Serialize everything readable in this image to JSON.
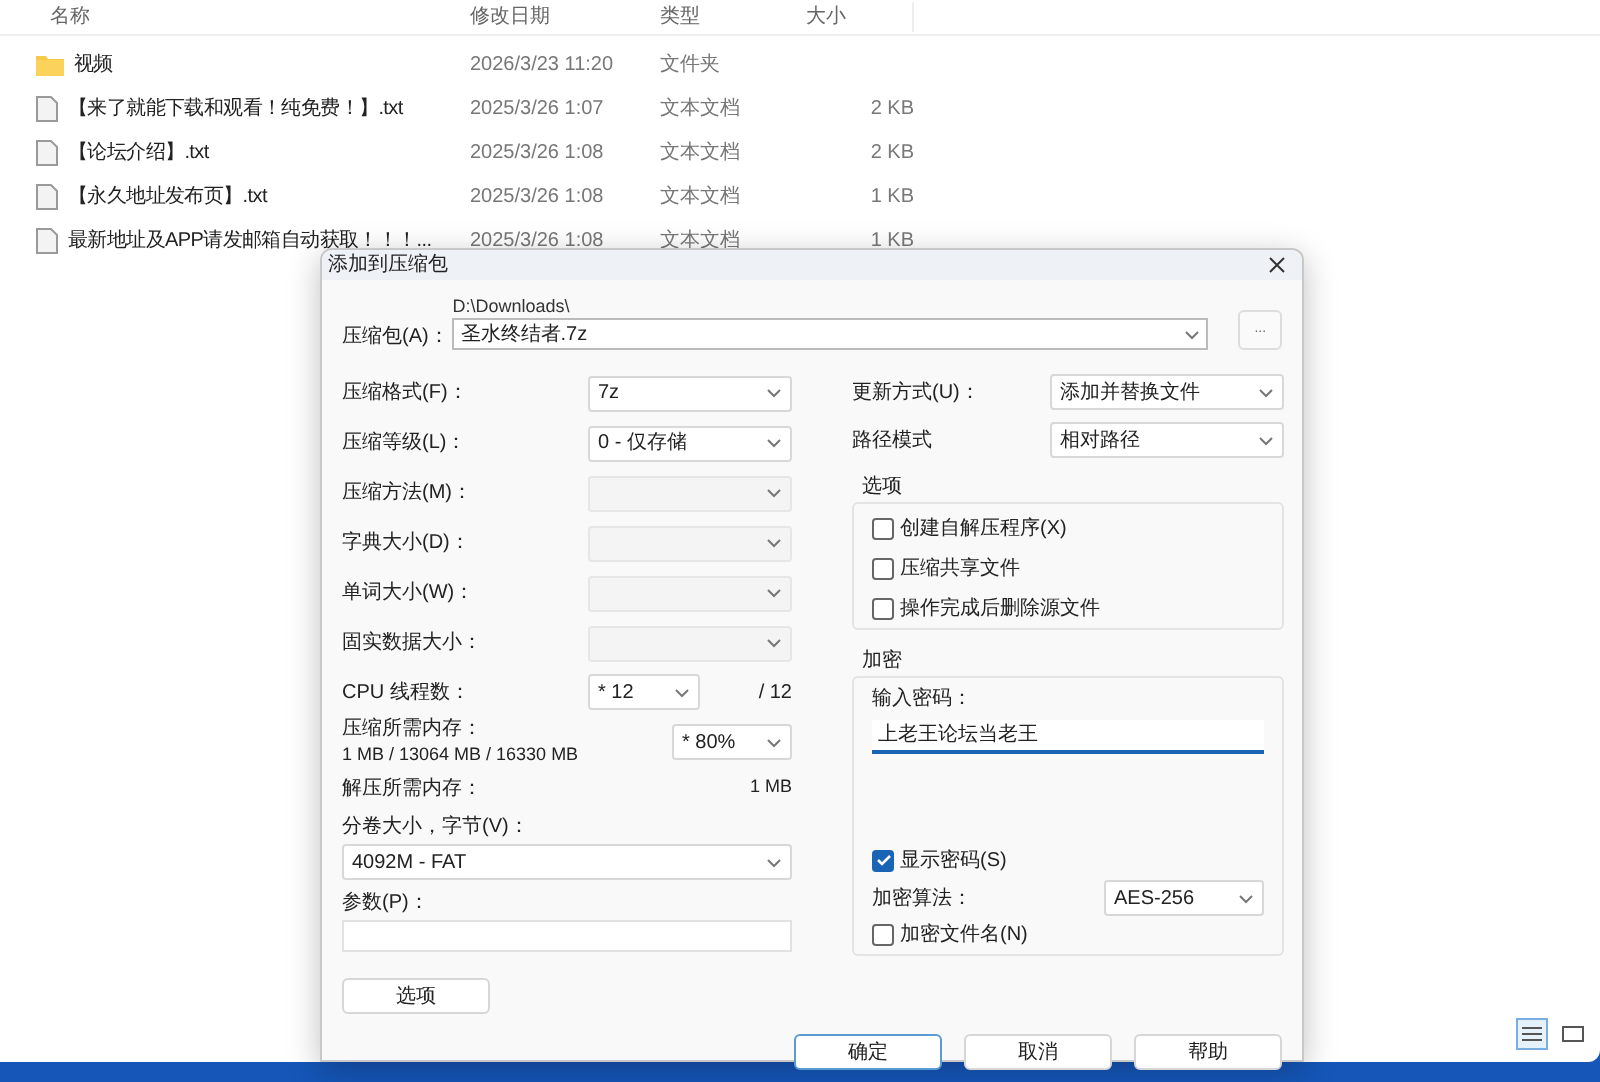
{
  "explorer": {
    "columns": [
      "名称",
      "修改日期",
      "类型",
      "大小"
    ],
    "rows": [
      {
        "kind": "folder",
        "name": "视频",
        "date": "2026/3/23 11:20",
        "type": "文件夹"
      },
      {
        "kind": "file",
        "name": "【来了就能下载和观看！纯免费！】.txt",
        "date": "2025/3/26 1:07",
        "type": "文本文档",
        "size": "2 KB"
      },
      {
        "kind": "file",
        "name": "【论坛介绍】.txt",
        "date": "2025/3/26 1:08",
        "type": "文本文档",
        "size": "2 KB"
      },
      {
        "kind": "file",
        "name": "【永久地址发布页】.txt",
        "date": "2025/3/26 1:08",
        "type": "文本文档",
        "size": "1 KB"
      },
      {
        "kind": "file",
        "name": "最新地址及APP请发邮箱自动获取！！！...",
        "date": "2025/3/26 1:08",
        "type": "文本文档",
        "size": "1 KB"
      }
    ],
    "view_buttons": [
      {
        "kind": "details",
        "selected": true
      },
      {
        "kind": "tiles",
        "selected": false
      }
    ]
  },
  "dialog": {
    "title": "添加到压缩包",
    "archive": {
      "label": "压缩包(A)：",
      "path": "D:\\Downloads\\",
      "value": "圣水终结者.7z",
      "browse": "..."
    },
    "left_fields": [
      {
        "label": "压缩格式(F)：",
        "value": "7z",
        "disabled": false
      },
      {
        "label": "压缩等级(L)：",
        "value": "0 - 仅存储",
        "disabled": false
      },
      {
        "label": "压缩方法(M)：",
        "disabled": true
      },
      {
        "label": "字典大小(D)：",
        "disabled": true
      },
      {
        "label": "单词大小(W)：",
        "disabled": true
      },
      {
        "label": "固实数据大小：",
        "disabled": true
      }
    ],
    "cpu": {
      "label": "CPU 线程数：",
      "value": "* 12",
      "total": "/ 12"
    },
    "memory": {
      "label": "压缩所需内存：",
      "detail": "1 MB / 13064 MB / 16330 MB",
      "value": "* 80%"
    },
    "decompress": {
      "label": "解压所需内存：",
      "value": "1 MB"
    },
    "volume": {
      "label": "分卷大小，字节(V)：",
      "value": "4092M - FAT"
    },
    "params": {
      "label": "参数(P)："
    },
    "options_button": "选项",
    "update": {
      "label": "更新方式(U)：",
      "value": "添加并替换文件"
    },
    "path_mode": {
      "label": "路径模式",
      "value": "相对路径"
    },
    "options_group": {
      "title": "选项",
      "checkboxes": [
        {
          "label": "创建自解压程序(X)",
          "checked": false
        },
        {
          "label": "压缩共享文件",
          "checked": false
        },
        {
          "label": "操作完成后删除源文件",
          "checked": false
        }
      ]
    },
    "encryption": {
      "title": "加密",
      "password_label": "输入密码：",
      "password": "上老王论坛当老王",
      "show_password": {
        "label": "显示密码(S)",
        "checked": true
      },
      "method_label": "加密算法：",
      "method": "AES-256",
      "encrypt_names": {
        "label": "加密文件名(N)",
        "checked": false
      }
    },
    "buttons": [
      {
        "label": "确定",
        "default": true
      },
      {
        "label": "取消",
        "default": false
      },
      {
        "label": "帮助",
        "default": false
      }
    ]
  }
}
